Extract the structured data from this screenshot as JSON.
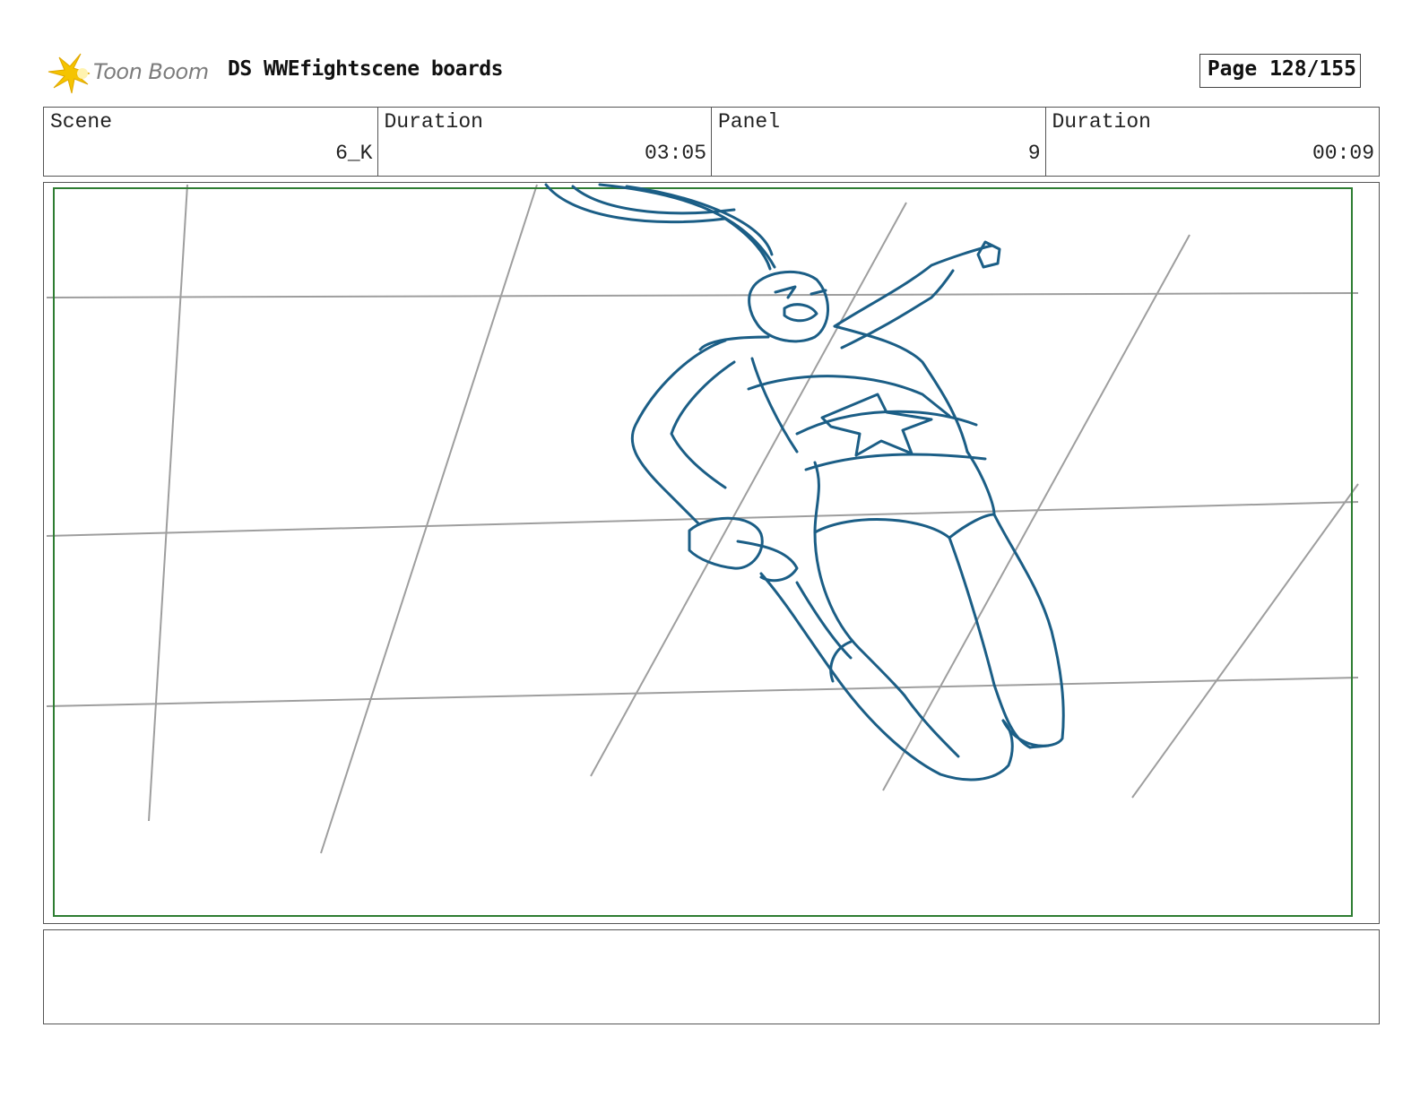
{
  "header": {
    "logo_text": "Toon Boom",
    "title": "DS WWEfightscene boards",
    "page": "Page 128/155"
  },
  "info": {
    "scene_label": "Scene",
    "scene_value": "6_K",
    "duration_label": "Duration",
    "duration_value": "03:05",
    "panel_label": "Panel",
    "panel_value": "9",
    "panel_duration_label": "Duration",
    "panel_duration_value": "00:09"
  },
  "colors": {
    "sketch": "#1b5e86",
    "grid": "#9e9e9e",
    "safe_frame": "#2e7d32",
    "logo_star": "#f5c400"
  },
  "notes": {
    "text": ""
  }
}
